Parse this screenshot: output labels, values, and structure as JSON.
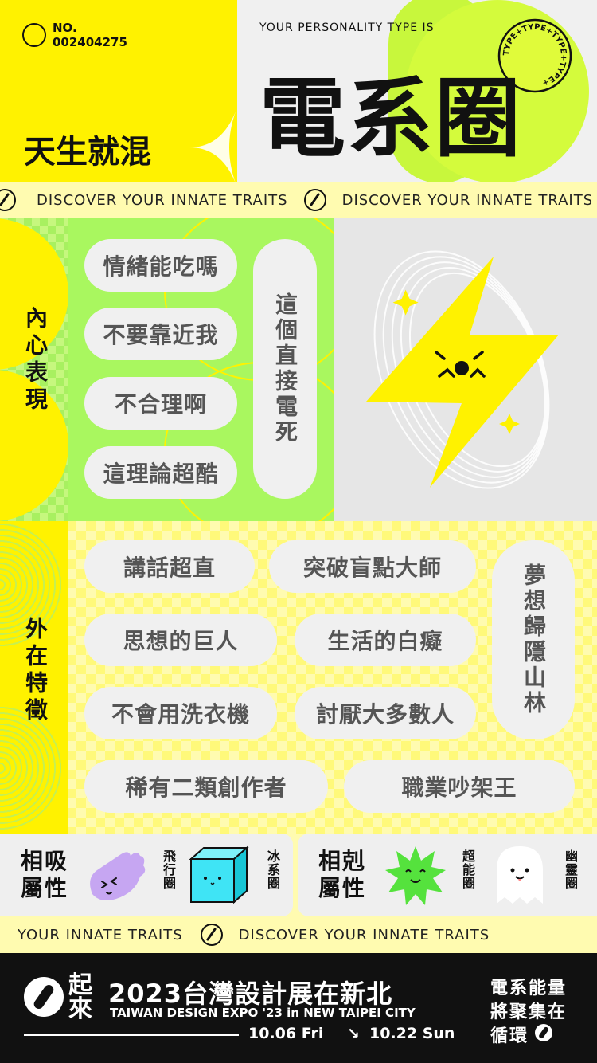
{
  "header": {
    "no_label": "NO.",
    "no_value": "002404275",
    "intro": "YOUR PERSONALITY TYPE IS",
    "type_name": "電系圈",
    "prefix": "天生就混",
    "badge_text": "TYPE+TYPE+TYPE+TYPE+"
  },
  "banner_top": {
    "text": "DISCOVER YOUR INNATE TRAITS"
  },
  "inner": {
    "label": "內心表現",
    "pills": [
      "情緒能吃嗎",
      "不要靠近我",
      "不合理啊",
      "這理論超酷"
    ],
    "vertical": "這個直接電死"
  },
  "outer": {
    "label": "外在特徵",
    "pills": [
      "講話超直",
      "突破盲點大師",
      "思想的巨人",
      "生活的白癡",
      "不會用洗衣機",
      "討厭大多數人",
      "稀有二類創作者",
      "職業吵架王"
    ],
    "vertical": "夢想歸隱山林"
  },
  "compat": {
    "attract_label": "相吸屬性",
    "attract": [
      {
        "name": "飛行圈",
        "icon": "purple-hand-icon",
        "color": "#c6a6f2"
      },
      {
        "name": "冰系圈",
        "icon": "cyan-cube-icon",
        "color": "#3fe4f5"
      }
    ],
    "conflict_label": "相剋屬性",
    "conflict": [
      {
        "name": "超能圈",
        "icon": "green-star-icon",
        "color": "#55e23d"
      },
      {
        "name": "幽靈圈",
        "icon": "ghost-icon",
        "color": "#ffffff"
      }
    ]
  },
  "banner_bottom": {
    "text_a": "YOUR INNATE TRAITS",
    "text_b": "DISCOVER YOUR INNATE TRAITS"
  },
  "footer": {
    "logo_text": "起來",
    "title": "2023台灣設計展在新北",
    "subtitle": "TAIWAN DESIGN EXPO '23 in NEW TAIPEI CITY",
    "date_start": "10.06 Fri",
    "arrow": "↘",
    "date_end": "10.22 Sun",
    "slogan": [
      "電系能量",
      "將聚集在",
      "循環"
    ]
  },
  "colors": {
    "yellow": "#fff200",
    "green": "#a8f560",
    "lightgreen": "#b8f57a",
    "grey": "#e6e6e6",
    "black": "#111111"
  }
}
